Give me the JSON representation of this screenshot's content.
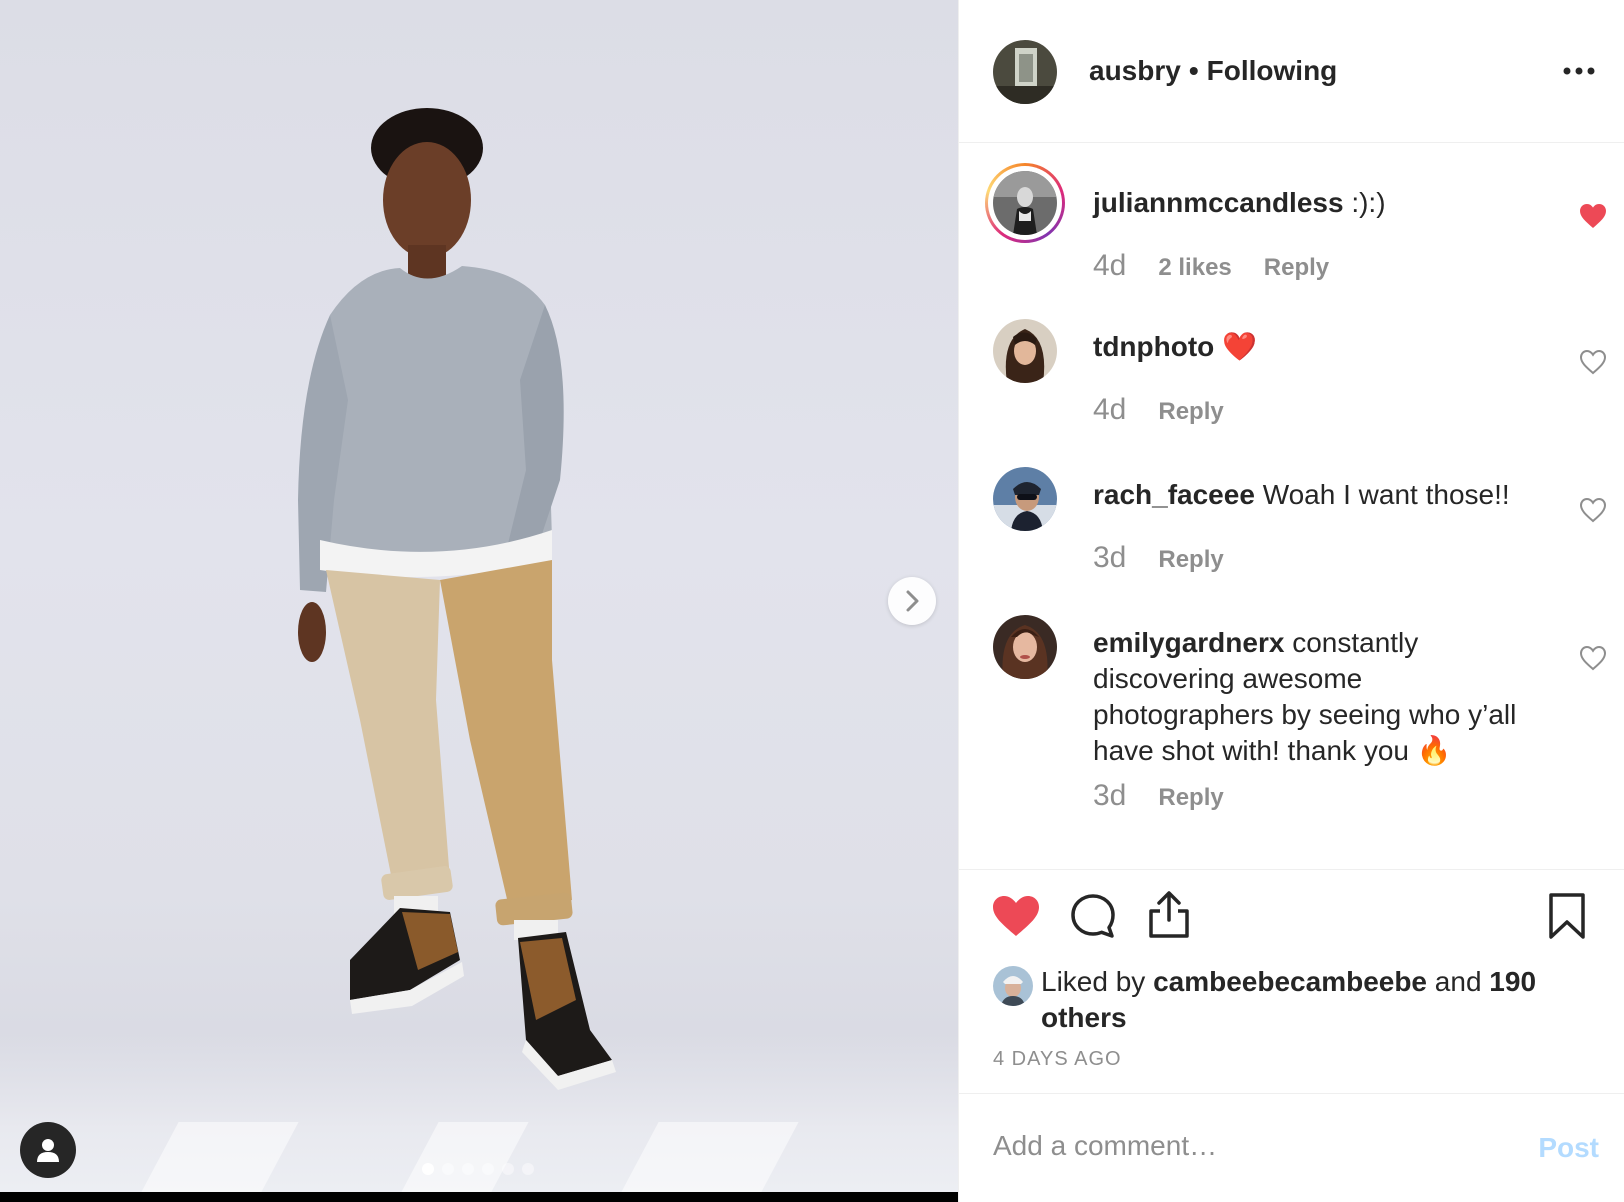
{
  "post": {
    "owner": "ausbry",
    "separator": "•",
    "follow_status": "Following"
  },
  "carousel": {
    "slide_count": 6,
    "active_index": 0
  },
  "comments": [
    {
      "username": "juliannmccandless",
      "text": ":):)",
      "age": "4d",
      "likes": "2 likes",
      "reply": "Reply",
      "liked": true
    },
    {
      "username": "tdnphoto",
      "text": "❤️",
      "age": "4d",
      "likes": "",
      "reply": "Reply",
      "liked": false
    },
    {
      "username": "rach_faceee",
      "text": "Woah I want those!!",
      "age": "3d",
      "likes": "",
      "reply": "Reply",
      "liked": false
    },
    {
      "username": "emilygardnerx",
      "text": "constantly discovering awesome photographers by seeing who y’all have shot with! thank you 🔥",
      "age": "3d",
      "likes": "",
      "reply": "Reply",
      "liked": false
    }
  ],
  "likes": {
    "prefix": "Liked by",
    "liker": "cambeebecambeebe",
    "conjunction": "and",
    "others": "190 others"
  },
  "timestamp": "4 DAYS AGO",
  "add_comment": {
    "placeholder": "Add a comment…",
    "post_label": "Post"
  },
  "colors": {
    "like_red": "#ed4956",
    "muted_text": "#8e8e8e",
    "post_disabled_blue": "#b3dbff"
  }
}
